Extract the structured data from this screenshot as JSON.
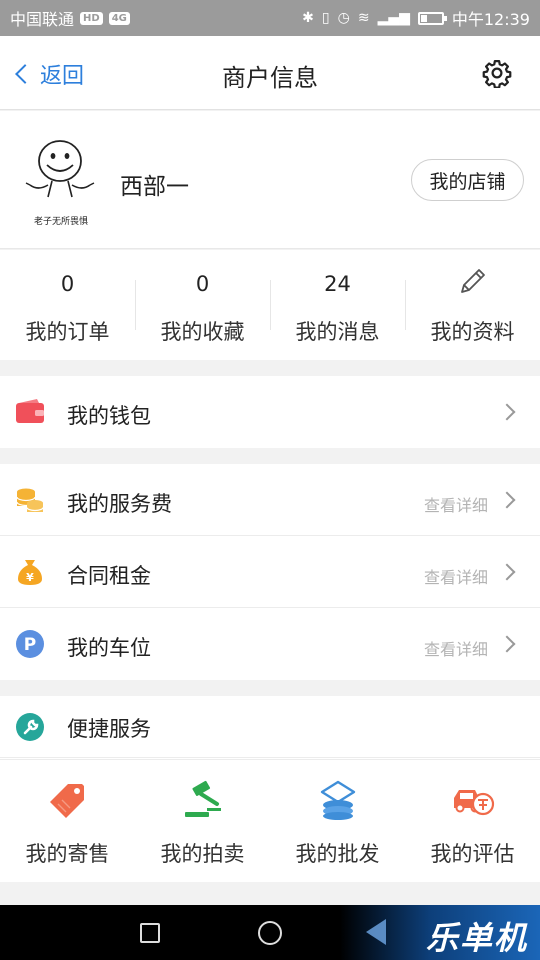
{
  "status_bar": {
    "carrier": "中国联通",
    "chip1": "HD",
    "chip2": "4G",
    "network": "4G",
    "time": "中午12:39"
  },
  "nav": {
    "back_label": "返回",
    "title": "商户信息"
  },
  "profile": {
    "avatar_caption": "老子无所畏惧",
    "name": "西部一",
    "shop_button": "我的店铺"
  },
  "stats": [
    {
      "value": "0",
      "label": "我的订单"
    },
    {
      "value": "0",
      "label": "我的收藏"
    },
    {
      "value": "24",
      "label": "我的消息"
    },
    {
      "label": "我的资料",
      "icon": "pencil-icon"
    }
  ],
  "wallet": {
    "label": "我的钱包",
    "icon": "wallet-icon",
    "color": "#f0505a"
  },
  "fees": [
    {
      "label": "我的服务费",
      "detail": "查看详细",
      "icon": "coins-icon",
      "color": "#f5b335"
    },
    {
      "label": "合同租金",
      "detail": "查看详细",
      "icon": "money-bag-icon",
      "color": "#f5a623"
    },
    {
      "label": "我的车位",
      "detail": "查看详细",
      "icon": "parking-icon",
      "color": "#5b8fe0"
    }
  ],
  "quick": {
    "label": "便捷服务",
    "icon": "wrench-icon",
    "color": "#26a69a",
    "tools": [
      {
        "label": "我的寄售",
        "icon": "tag-icon",
        "color": "#f06a4a"
      },
      {
        "label": "我的拍卖",
        "icon": "gavel-icon",
        "color": "#2eaa4f"
      },
      {
        "label": "我的批发",
        "icon": "wholesale-icon",
        "color": "#3f8ed8"
      },
      {
        "label": "我的评估",
        "icon": "car-appraisal-icon",
        "color": "#f06a4a"
      }
    ]
  },
  "watermark": {
    "brand": "乐单机"
  }
}
